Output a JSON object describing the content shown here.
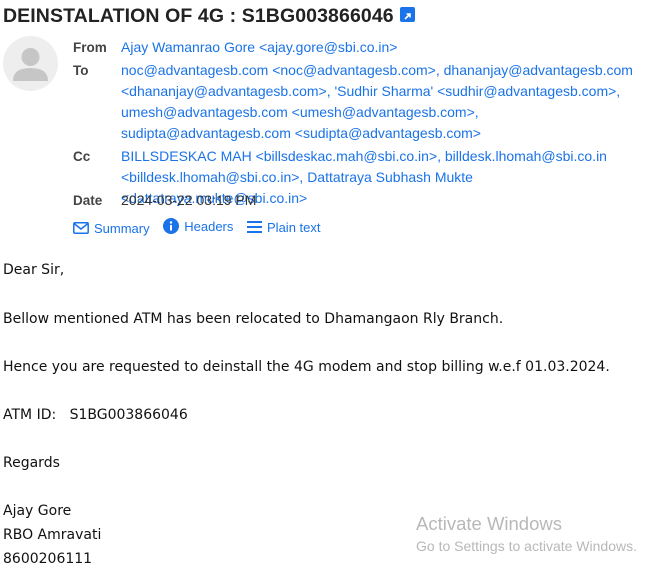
{
  "email": {
    "subject": "DEINSTALATION OF 4G : S1BG003866046",
    "from_label": "From",
    "from": "Ajay Wamanrao Gore <ajay.gore@sbi.co.in>",
    "to_label": "To",
    "to": "noc@advantagesb.com <noc@advantagesb.com>, dhananjay@advantagesb.com <dhananjay@advantagesb.com>, 'Sudhir Sharma' <sudhir@advantagesb.com>, umesh@advantagesb.com <umesh@advantagesb.com>, sudipta@advantagesb.com <sudipta@advantagesb.com>",
    "cc_label": "Cc",
    "cc": "BILLSDESKAC MAH <billsdeskac.mah@sbi.co.in>, billdesk.lhomah@sbi.co.in <billdesk.lhomah@sbi.co.in>, Dattatraya Subhash Mukte <dattatraya.mukte@sbi.co.in>",
    "date_label": "Date",
    "date": "2024-03-22 03:19 PM"
  },
  "actions": {
    "summary": "Summary",
    "headers": "Headers",
    "plain_text": "Plain text"
  },
  "body": {
    "greeting": "Dear Sir,",
    "line1": "Bellow mentioned ATM has been relocated to Dhamangaon Rly Branch.",
    "line2": "Hence you are requested to deinstall the 4G modem and stop billing w.e.f 01.03.2024.",
    "atm_label": "ATM ID:",
    "atm_id": "S1BG003866046",
    "regards": "Regards",
    "sig_name": "Ajay Gore",
    "sig_office": "RBO Amravati",
    "sig_phone": "8600206111"
  },
  "watermark": {
    "title": "Activate Windows",
    "subtitle": "Go to Settings to activate Windows."
  },
  "colors": {
    "link": "#1a73e8",
    "label": "#444444"
  },
  "icons": [
    "open-external-icon",
    "avatar-icon",
    "mail-icon",
    "info-icon",
    "lines-icon"
  ]
}
